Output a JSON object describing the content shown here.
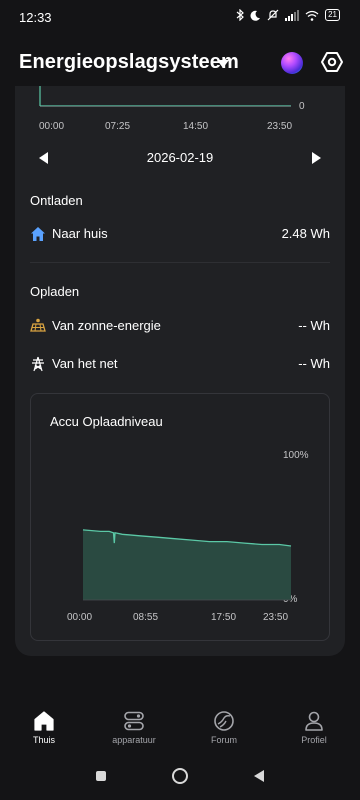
{
  "status_bar": {
    "time": "12:33",
    "battery": "21",
    "icons": [
      "bluetooth-icon",
      "moon-icon",
      "mute-icon",
      "signal-icon",
      "wifi-icon",
      "battery-icon"
    ]
  },
  "header": {
    "title": "Energieopslagsysteem",
    "dropdown_icon": "caret-down-icon",
    "assistant_icon": "assistant-orb-icon",
    "settings_icon": "gear-icon"
  },
  "top_chart": {
    "x_ticks": [
      "00:00",
      "07:25",
      "14:50",
      "23:50"
    ],
    "y_tick": "0",
    "line_color": "#5bc8a6"
  },
  "date_nav": {
    "date": "2026-02-19",
    "prev_icon": "chevron-left-icon",
    "next_icon": "chevron-right-icon"
  },
  "discharge": {
    "heading": "Ontladen",
    "items": [
      {
        "icon": "house-icon",
        "label": "Naar huis",
        "value": "2.48 Wh"
      }
    ]
  },
  "charge": {
    "heading": "Opladen",
    "items": [
      {
        "icon": "solar-panel-icon",
        "label": "Van zonne-energie",
        "value": "-- Wh"
      },
      {
        "icon": "power-tower-icon",
        "label": "Van het net",
        "value": "-- Wh"
      }
    ]
  },
  "battery_chart": {
    "title": "Accu Oplaadniveau",
    "y_top_label": "100%",
    "y_bottom_label": "0%",
    "x_ticks": [
      "00:00",
      "08:55",
      "17:50",
      "23:50"
    ],
    "line_color": "#5bc8a6",
    "fill_color": "#2a4a41"
  },
  "chart_data": {
    "type": "area",
    "title": "Accu Oplaadniveau",
    "xlabel": "",
    "ylabel": "",
    "x": [
      "00:00",
      "02:00",
      "03:00",
      "03:30",
      "03:35",
      "03:40",
      "04:30",
      "06:30",
      "08:30",
      "10:30",
      "12:30",
      "14:30",
      "16:30",
      "18:30",
      "20:30",
      "22:30",
      "23:50"
    ],
    "series": [
      {
        "values": [
          48,
          47,
          47,
          46,
          39,
          46,
          45,
          44,
          43,
          42,
          41,
          40,
          40,
          39,
          38,
          38,
          37
        ]
      }
    ],
    "ylim": [
      0,
      100
    ],
    "y_tick_labels": [
      "0%",
      "100%"
    ],
    "grid": false
  },
  "bottom_nav": {
    "items": [
      {
        "icon": "home-icon",
        "label": "Thuis",
        "active": true
      },
      {
        "icon": "devices-icon",
        "label": "apparatuur",
        "active": false
      },
      {
        "icon": "forum-icon",
        "label": "Forum",
        "active": false
      },
      {
        "icon": "profile-icon",
        "label": "Profiel",
        "active": false
      }
    ]
  },
  "system_nav": {
    "icons": [
      "recent-apps-icon",
      "home-circle-icon",
      "back-icon"
    ]
  }
}
